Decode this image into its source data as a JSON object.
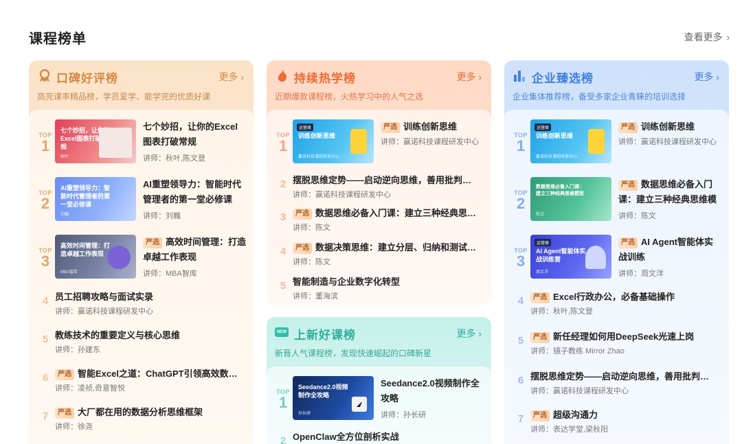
{
  "page_title": "课程榜单",
  "view_more": "查看更多",
  "badge_label": "严选",
  "top_label": "TOP",
  "lecturer_prefix": "讲师：",
  "boards": {
    "koubei": {
      "name": "口碑好评榜",
      "more": "更多",
      "subtitle": "高完课率精品榜，学员爱学、能学完的优质好课",
      "accent": "#d58a45",
      "items": [
        {
          "rank": "1",
          "title": "七个妙招，让你的Excel图表打破常规",
          "lecturer": "秋叶,陈文登",
          "thumb_text": "七个妙招，让你的Excel图表打破常规",
          "thumb_footer": "秋叶"
        },
        {
          "rank": "2",
          "title": "AI重塑领导力：智能时代管理者的第一堂必修课",
          "lecturer": "刘巍",
          "thumb_text": "AI重塑领导力：智能时代管理者的第一堂必修课",
          "thumb_footer": "刘巍"
        },
        {
          "rank": "3",
          "title": "高效时间管理：打造卓越工作表现",
          "lecturer": "MBA智库",
          "thumb_text": "高效时间管理：打造卓越工作表现",
          "thumb_footer": "MBA智库",
          "badge": true
        },
        {
          "rank": "4",
          "title": "员工招聘攻略与面试实录",
          "lecturer": "赢诺科技课程研发中心"
        },
        {
          "rank": "5",
          "title": "教练技术的重要定义与核心思维",
          "lecturer": "孙建东"
        },
        {
          "rank": "6",
          "title": "智能Excel之道：ChatGPT引领高效数据处理",
          "lecturer": "凌祯,奇意智悦",
          "badge": true
        },
        {
          "rank": "7",
          "title": "大厂都在用的数据分析思维框架",
          "lecturer": "徐尧",
          "badge": true
        }
      ]
    },
    "rexue": {
      "name": "持续热学榜",
      "more": "更多",
      "subtitle": "近期爆款课程榜，火热学习中的人气之选",
      "accent": "#e8763f",
      "items": [
        {
          "rank": "1",
          "title": "训练创新思维",
          "lecturer": "赢诺科技课程研发中心",
          "thumb_text": "训练创新思维",
          "thumb_tag": "运营类",
          "thumb_footer": "赢诺科技课程研发中心",
          "badge": true
        },
        {
          "rank": "2",
          "title": "摆脱思维定势——启动逆向思维，善用批判性思维",
          "lecturer": "赢诺科技课程研发中心"
        },
        {
          "rank": "3",
          "title": "数据思维必备入门课：建立三种经典思维模型",
          "lecturer": "陈文",
          "badge": true
        },
        {
          "rank": "4",
          "title": "数据决策思维：建立分层、归纳和测试思维",
          "lecturer": "陈文",
          "badge": true
        },
        {
          "rank": "5",
          "title": "智能制造与企业数字化转型",
          "lecturer": "董海滨"
        }
      ]
    },
    "shangxin": {
      "name": "上新好课榜",
      "more": "更多",
      "subtitle": "新晋人气课程榜，发现快速崛起的口碑新星",
      "accent": "#2fae9d",
      "icon_text": "NEW",
      "items": [
        {
          "rank": "1",
          "title": "Seedance2.0视频制作全攻略",
          "lecturer": "孙长研",
          "thumb_text": "Seedance2.0视频制作全攻略",
          "thumb_footer": "孙长研"
        },
        {
          "rank": "2",
          "title": "OpenClaw全方位剖析实战"
        }
      ]
    },
    "qiye": {
      "name": "企业臻选榜",
      "more": "更多",
      "subtitle": "企业集体推荐榜，备受多家企业青睐的培训选择",
      "accent": "#3f7fe0",
      "items": [
        {
          "rank": "1",
          "title": "训练创新思维",
          "lecturer": "赢诺科技课程研发中心",
          "thumb_text": "训练创新思维",
          "thumb_tag": "运营类",
          "thumb_footer": "赢诺科技课程研发中心",
          "badge": true
        },
        {
          "rank": "2",
          "title": "数据思维必备入门课：建立三种经典思维模型",
          "lecturer": "陈文",
          "thumb_text": "数据思维必备入门课：建立三种经典思维模型",
          "thumb_footer": "陈文",
          "badge": true
        },
        {
          "rank": "3",
          "title": "AI Agent智能体实战训练",
          "lecturer": "周文洋",
          "thumb_text": "AI Agent智能体实战训练营",
          "thumb_tag": "运营类",
          "thumb_footer": "周文洋",
          "badge": true
        },
        {
          "rank": "4",
          "title": "Excel行政办公，必备基础操作",
          "lecturer": "秋叶,陈文登",
          "badge": true
        },
        {
          "rank": "5",
          "title": "新任经理如何用DeepSeek光速上岗",
          "lecturer": "镜子教练 Mirror Zhao",
          "badge": true
        },
        {
          "rank": "6",
          "title": "摆脱思维定势——启动逆向思维，善用批判性思维",
          "lecturer": "赢诺科技课程研发中心"
        },
        {
          "rank": "7",
          "title": "超级沟通力",
          "lecturer": "表达学堂,梁秋阳",
          "badge": true
        }
      ]
    }
  }
}
